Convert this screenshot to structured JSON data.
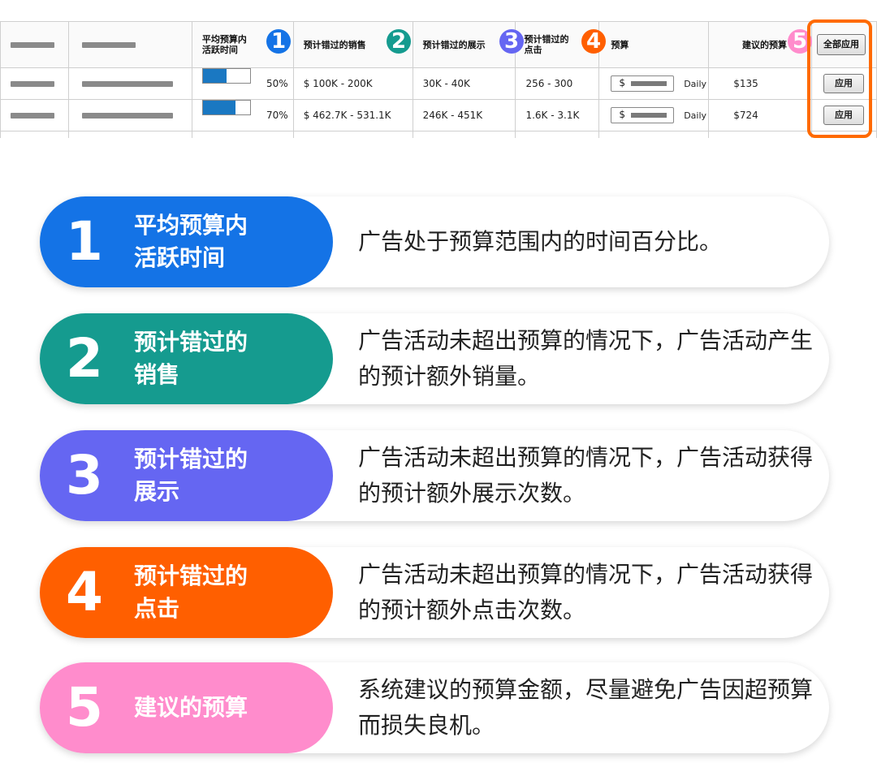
{
  "table": {
    "headers": {
      "avg_active": "平均预算内\n活跃时间",
      "missed_sales": "预计错过的销售",
      "missed_impressions": "预计错过的展示",
      "missed_clicks": "预计错过的\n点击",
      "budget": "预算",
      "suggested_budget": "建议的预算",
      "apply_all": "全部应用"
    },
    "badges": [
      "1",
      "2",
      "3",
      "4",
      "5"
    ],
    "rows": [
      {
        "progress_pct": 50,
        "progress_label": "50%",
        "sales": "$ 100K - 200K",
        "impressions": "30K - 40K",
        "clicks": "256 - 300",
        "currency": "$",
        "period": "Daily",
        "suggested": "$135",
        "apply": "应用"
      },
      {
        "progress_pct": 70,
        "progress_label": "70%",
        "sales": "$ 462.7K - 531.1K",
        "impressions": "246K - 451K",
        "clicks": "1.6K - 3.1K",
        "currency": "$",
        "period": "Daily",
        "suggested": "$724",
        "apply": "应用"
      }
    ]
  },
  "legend": [
    {
      "num": "1",
      "title": "平均预算内\n活跃时间",
      "desc": "广告处于预算范围内的时间百分比。",
      "color": "#1473e6"
    },
    {
      "num": "2",
      "title": "预计错过的\n销售",
      "desc": "广告活动未超出预算的情况下，广告活动产生的预计额外销量。",
      "color": "#159b8f"
    },
    {
      "num": "3",
      "title": "预计错过的\n展示",
      "desc": "广告活动未超出预算的情况下，广告活动获得的预计额外展示次数。",
      "color": "#6566f2"
    },
    {
      "num": "4",
      "title": "预计错过的\n点击",
      "desc": "广告活动未超出预算的情况下，广告活动获得的预计额外点击次数。",
      "color": "#ff5f00"
    },
    {
      "num": "5",
      "title": "建议的预算",
      "desc": "系统建议的预算金额，尽量避免广告因超预算而损失良机。",
      "color": "#ff8ccc"
    }
  ]
}
